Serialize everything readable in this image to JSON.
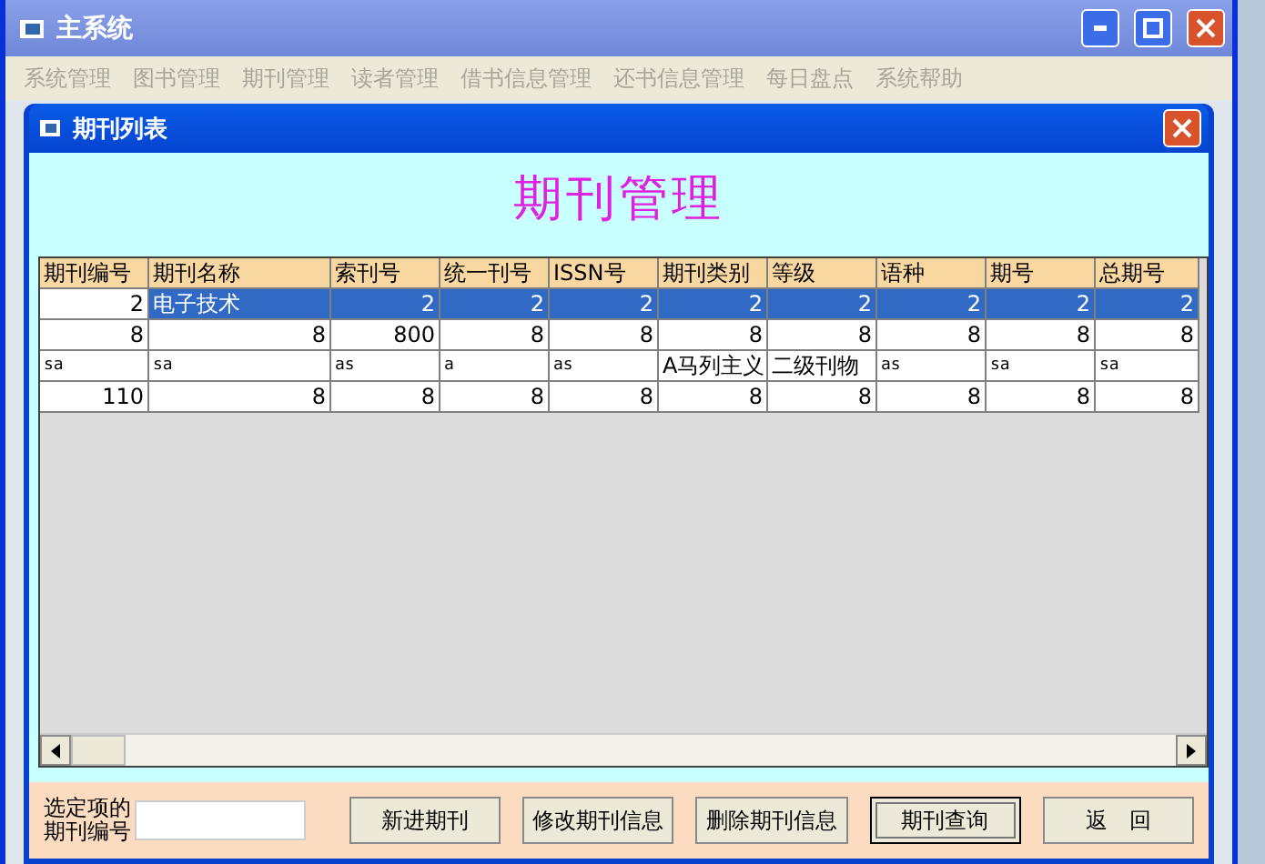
{
  "window": {
    "title": "主系统"
  },
  "menu": [
    "系统管理",
    "图书管理",
    "期刊管理",
    "读者管理",
    "借书信息管理",
    "还书信息管理",
    "每日盘点",
    "系统帮助"
  ],
  "child_window": {
    "title": "期刊列表"
  },
  "heading": "期刊管理",
  "table": {
    "columns": [
      "期刊编号",
      "期刊名称",
      "索刊号",
      "统一刊号",
      "ISSN号",
      "期刊类别",
      "等级",
      "语种",
      "期号",
      "总期号"
    ],
    "rows": [
      {
        "selected": true,
        "cells": [
          {
            "text": "2",
            "kind": "number"
          },
          {
            "text": "电子技术",
            "kind": "text"
          },
          {
            "text": "2",
            "kind": "number"
          },
          {
            "text": "2",
            "kind": "number"
          },
          {
            "text": "2",
            "kind": "number"
          },
          {
            "text": "2",
            "kind": "number"
          },
          {
            "text": "2",
            "kind": "number"
          },
          {
            "text": "2",
            "kind": "number"
          },
          {
            "text": "2",
            "kind": "number"
          },
          {
            "text": "2",
            "kind": "number"
          }
        ]
      },
      {
        "selected": false,
        "cells": [
          {
            "text": "8",
            "kind": "number"
          },
          {
            "text": "8",
            "kind": "number"
          },
          {
            "text": "800",
            "kind": "number"
          },
          {
            "text": "8",
            "kind": "number"
          },
          {
            "text": "8",
            "kind": "number"
          },
          {
            "text": "8",
            "kind": "number"
          },
          {
            "text": "8",
            "kind": "number"
          },
          {
            "text": "8",
            "kind": "number"
          },
          {
            "text": "8",
            "kind": "number"
          },
          {
            "text": "8",
            "kind": "number"
          }
        ]
      },
      {
        "selected": false,
        "cells": [
          {
            "text": "sa",
            "kind": "code"
          },
          {
            "text": "sa",
            "kind": "code"
          },
          {
            "text": "as",
            "kind": "code"
          },
          {
            "text": "a",
            "kind": "code"
          },
          {
            "text": "as",
            "kind": "code"
          },
          {
            "text": "A马列主义",
            "kind": "text"
          },
          {
            "text": "二级刊物",
            "kind": "text"
          },
          {
            "text": "as",
            "kind": "code"
          },
          {
            "text": "sa",
            "kind": "code"
          },
          {
            "text": "sa",
            "kind": "code"
          }
        ]
      },
      {
        "selected": false,
        "cells": [
          {
            "text": "110",
            "kind": "number"
          },
          {
            "text": "8",
            "kind": "number"
          },
          {
            "text": "8",
            "kind": "number"
          },
          {
            "text": "8",
            "kind": "number"
          },
          {
            "text": "8",
            "kind": "number"
          },
          {
            "text": "8",
            "kind": "number"
          },
          {
            "text": "8",
            "kind": "number"
          },
          {
            "text": "8",
            "kind": "number"
          },
          {
            "text": "8",
            "kind": "number"
          },
          {
            "text": "8",
            "kind": "number"
          }
        ]
      }
    ]
  },
  "selected_id": {
    "label": "选定项的期刊编号"
  },
  "buttons": [
    {
      "label": "新进期刊",
      "focused": false
    },
    {
      "label": "修改期刊信息",
      "focused": false
    },
    {
      "label": "删除期刊信息",
      "focused": false
    },
    {
      "label": "期刊查询",
      "focused": true
    },
    {
      "label": "返　回",
      "focused": false
    }
  ]
}
